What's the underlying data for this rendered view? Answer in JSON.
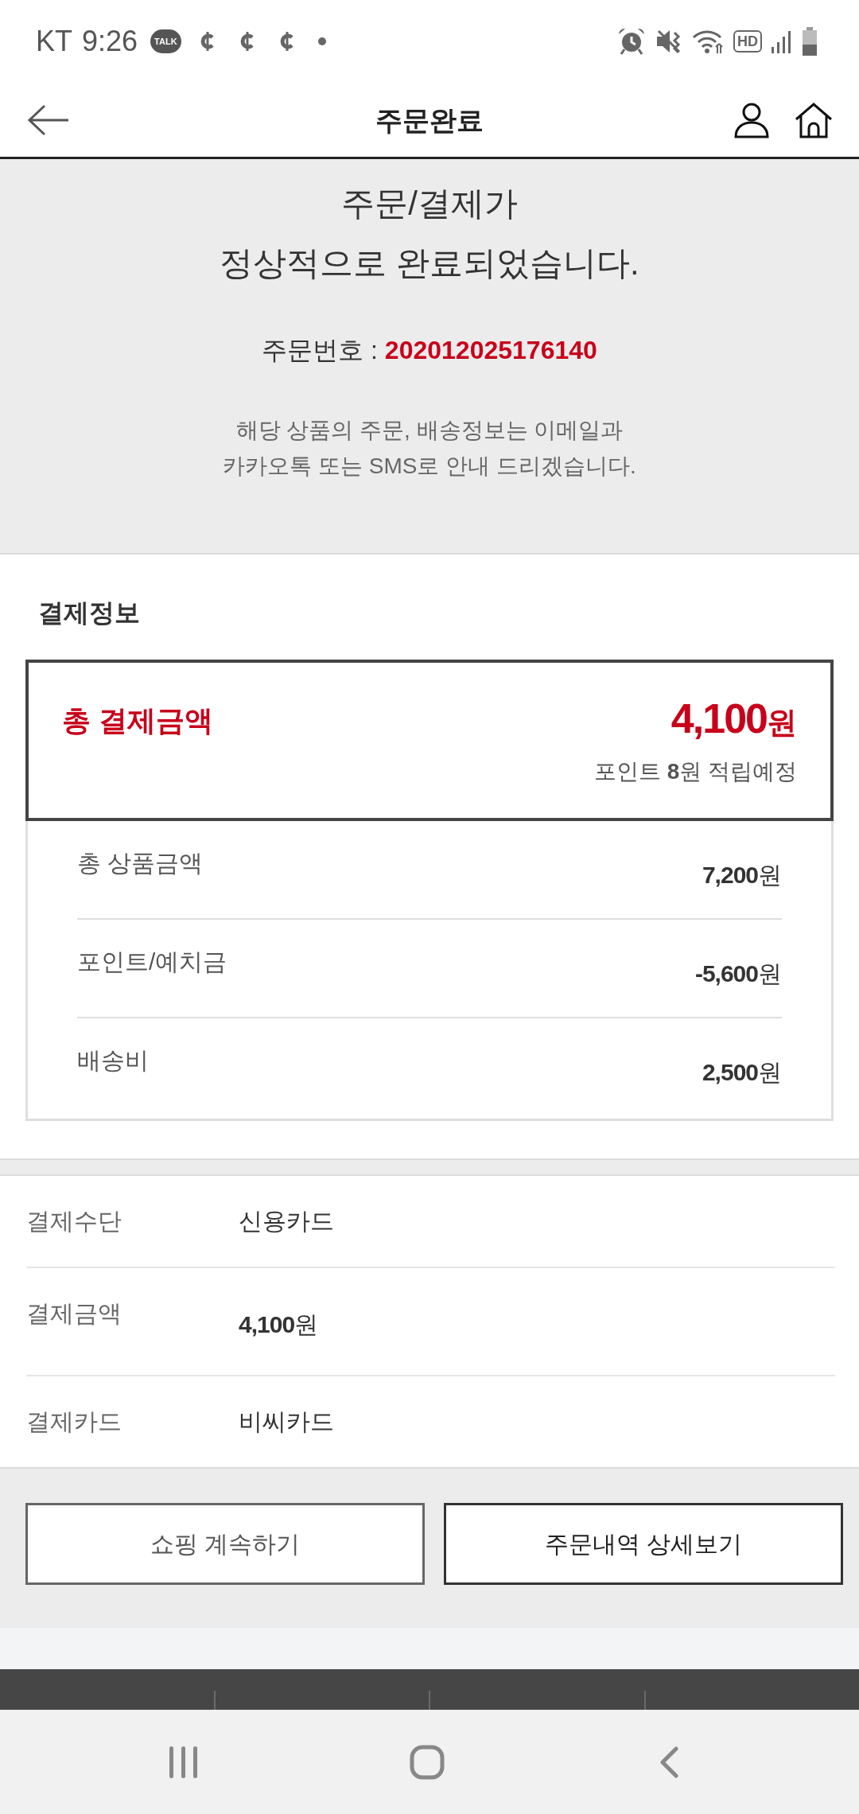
{
  "status_bar": {
    "carrier": "KT",
    "time": "9:26",
    "chat_badge": "TALK",
    "hd_badge": "HD"
  },
  "header": {
    "title": "주문완료"
  },
  "completion": {
    "title_lines": [
      "주문/결제가",
      "정상적으로 완료되었습니다."
    ],
    "order_number_label": "주문번호 :",
    "order_number": "202012025176140",
    "notice_lines": [
      "해당 상품의 주문, 배송정보는 이메일과",
      "카카오톡 또는 SMS로 안내 드리겠습니다."
    ]
  },
  "payment_info": {
    "heading": "결제정보",
    "total": {
      "label": "총 결제금액",
      "amount": "4,100",
      "unit": "원",
      "points_note": "포인트 **8**원 적립예정"
    },
    "breakdown": [
      {
        "label": "총 상품금액",
        "amount": "7,200",
        "unit": "원"
      },
      {
        "label": "포인트/예치금",
        "amount": "-5,600",
        "unit": "원"
      },
      {
        "label": "배송비",
        "amount": "2,500",
        "unit": "원"
      }
    ]
  },
  "payment_method": {
    "rows": [
      {
        "kind": "text",
        "label": "결제수단",
        "value": "신용카드"
      },
      {
        "kind": "amount",
        "label": "결제금액",
        "value": "4,100",
        "unit": "원"
      },
      {
        "kind": "text",
        "label": "결제카드",
        "value": "비씨카드"
      }
    ]
  },
  "buttons": [
    {
      "kind": "secondary",
      "label": "쇼핑 계속하기"
    },
    {
      "kind": "primary",
      "label": "주문내역 상세보기"
    }
  ]
}
